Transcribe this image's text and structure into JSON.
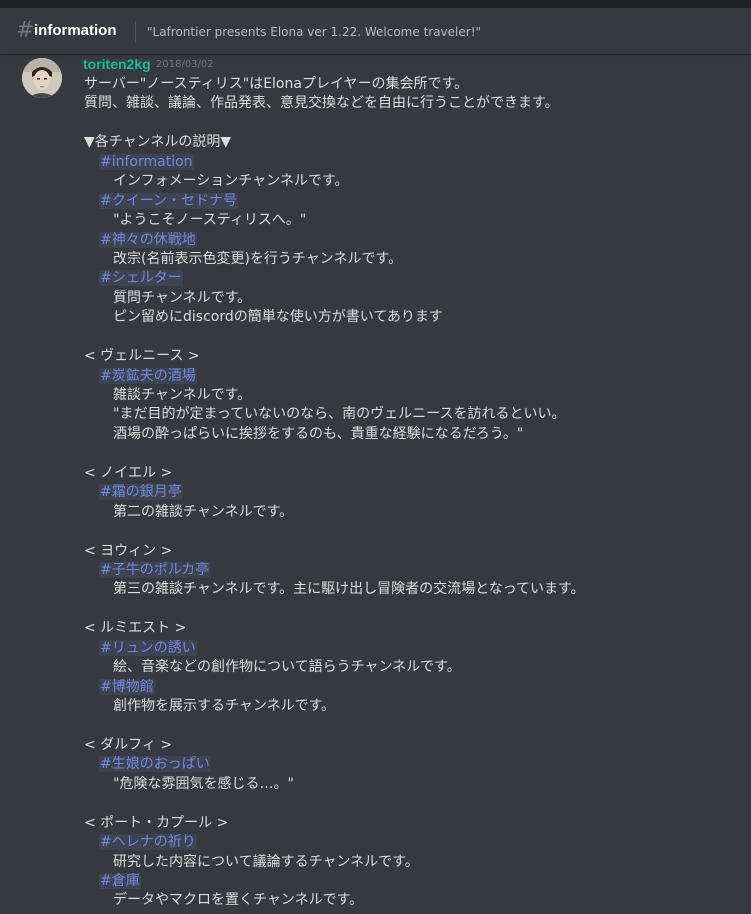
{
  "header": {
    "channel_name": "information",
    "topic": "\"Lafrontier presents Elona ver 1.22. Welcome traveler!\""
  },
  "message": {
    "username": "toriten2kg",
    "timestamp": "2018/03/02",
    "lines": [
      {
        "text": "サーバー\"ノースティリス\"はElonaプレイヤーの集会所です。",
        "indent": 0,
        "mention": false
      },
      {
        "text": "質問、雑談、議論、作品発表、意見交換などを自由に行うことができます。",
        "indent": 0,
        "mention": false
      },
      {
        "text": "",
        "indent": 0,
        "mention": false
      },
      {
        "text": "▼各チャンネルの説明▼",
        "indent": 0,
        "mention": false
      },
      {
        "text": "#information",
        "indent": 1,
        "mention": true
      },
      {
        "text": "インフォメーションチャンネルです。",
        "indent": 2,
        "mention": false
      },
      {
        "text": "#クイーン・セドナ号",
        "indent": 1,
        "mention": true
      },
      {
        "text": "\"ようこそノースティリスへ。\"",
        "indent": 2,
        "mention": false
      },
      {
        "text": "#神々の休戦地",
        "indent": 1,
        "mention": true
      },
      {
        "text": "改宗(名前表示色変更)を行うチャンネルです。",
        "indent": 2,
        "mention": false
      },
      {
        "text": "#シェルター",
        "indent": 1,
        "mention": true
      },
      {
        "text": "質問チャンネルです。",
        "indent": 2,
        "mention": false
      },
      {
        "text": "ピン留めにdiscordの簡単な使い方が書いてあります",
        "indent": 2,
        "mention": false
      },
      {
        "text": "",
        "indent": 0,
        "mention": false
      },
      {
        "text": "< ヴェルニース >",
        "indent": 0,
        "mention": false
      },
      {
        "text": "#炭鉱夫の酒場",
        "indent": 1,
        "mention": true
      },
      {
        "text": "雑談チャンネルです。",
        "indent": 2,
        "mention": false
      },
      {
        "text": "\"まだ目的が定まっていないのなら、南のヴェルニースを訪れるといい。",
        "indent": 2,
        "mention": false
      },
      {
        "text": "酒場の酔っぱらいに挨拶をするのも、貴重な経験になるだろう。\"",
        "indent": 2,
        "mention": false
      },
      {
        "text": "",
        "indent": 0,
        "mention": false
      },
      {
        "text": "< ノイエル >",
        "indent": 0,
        "mention": false
      },
      {
        "text": "#霜の銀月亭",
        "indent": 1,
        "mention": true
      },
      {
        "text": "第二の雑談チャンネルです。",
        "indent": 2,
        "mention": false
      },
      {
        "text": "",
        "indent": 0,
        "mention": false
      },
      {
        "text": "< ヨウィン >",
        "indent": 0,
        "mention": false
      },
      {
        "text": "#子牛のポルカ亭",
        "indent": 1,
        "mention": true
      },
      {
        "text": "第三の雑談チャンネルです。主に駆け出し冒険者の交流場となっています。",
        "indent": 2,
        "mention": false
      },
      {
        "text": "",
        "indent": 0,
        "mention": false
      },
      {
        "text": "< ルミエスト >",
        "indent": 0,
        "mention": false
      },
      {
        "text": "#リュンの誘い",
        "indent": 1,
        "mention": true
      },
      {
        "text": "絵、音楽などの創作物について語らうチャンネルです。",
        "indent": 2,
        "mention": false
      },
      {
        "text": "#博物館",
        "indent": 1,
        "mention": true
      },
      {
        "text": "創作物を展示するチャンネルです。",
        "indent": 2,
        "mention": false
      },
      {
        "text": "",
        "indent": 0,
        "mention": false
      },
      {
        "text": "< ダルフィ >",
        "indent": 0,
        "mention": false
      },
      {
        "text": "#生娘のおっぱい",
        "indent": 1,
        "mention": true
      },
      {
        "text": "\"危険な雰囲気を感じる…。\"",
        "indent": 2,
        "mention": false
      },
      {
        "text": "",
        "indent": 0,
        "mention": false
      },
      {
        "text": "< ポート・カプール >",
        "indent": 0,
        "mention": false
      },
      {
        "text": "#ヘレナの祈り",
        "indent": 1,
        "mention": true
      },
      {
        "text": "研究した内容について議論するチャンネルです。",
        "indent": 2,
        "mention": false
      },
      {
        "text": "#倉庫",
        "indent": 1,
        "mention": true
      },
      {
        "text": "データやマクロを置くチャンネルです。",
        "indent": 2,
        "mention": false
      }
    ]
  },
  "colors": {
    "background": "#36393f",
    "username": "#1abc9c",
    "mention": "#7289da",
    "text": "#dcddde",
    "muted": "#72767d"
  },
  "icons": {
    "channel": "hash-icon",
    "avatar": "avatar"
  }
}
